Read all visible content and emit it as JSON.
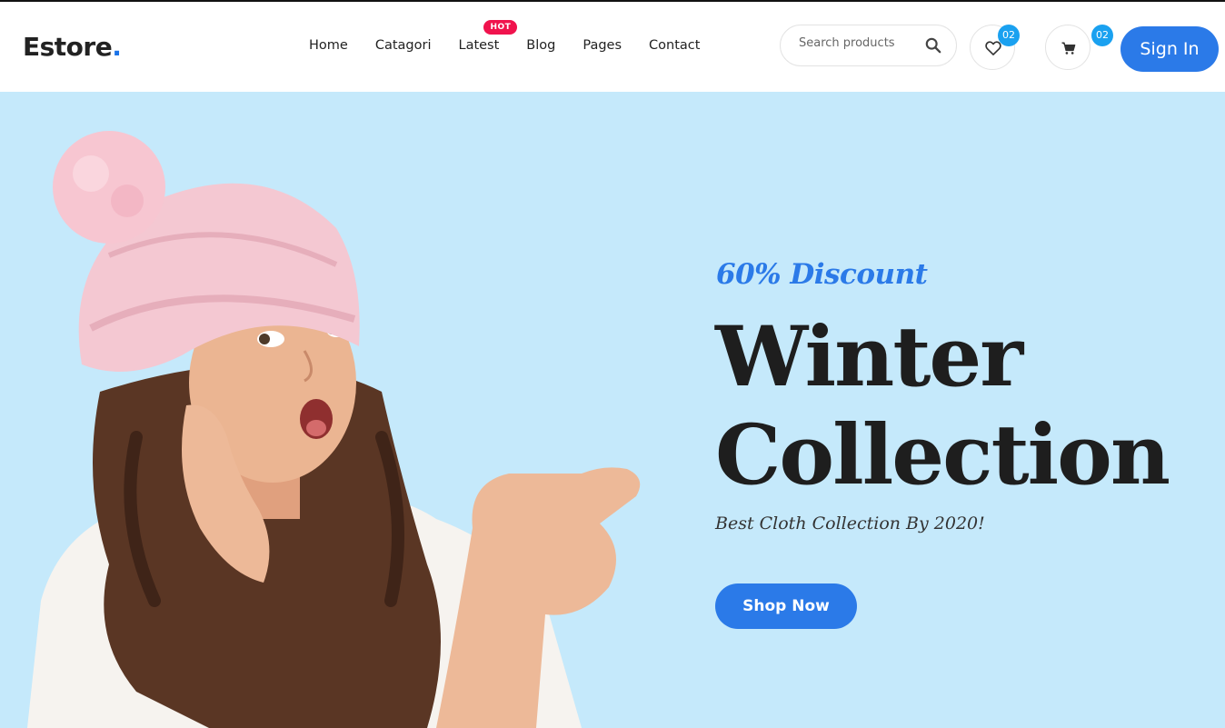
{
  "brand": {
    "name": "Estore",
    "dot": "."
  },
  "nav": {
    "items": [
      "Home",
      "Catagori",
      "Latest",
      "Blog",
      "Pages",
      "Contact"
    ],
    "hot_badge": "HOT"
  },
  "search": {
    "placeholder": "Search products",
    "icon": "search-icon"
  },
  "wishlist": {
    "icon": "heart-icon",
    "count": "02"
  },
  "cart": {
    "icon": "cart-icon",
    "count": "02"
  },
  "signin_label": "Sign In",
  "hero": {
    "discount": "60% Discount",
    "title_line1": "Winter",
    "title_line2": "Collection",
    "subtitle": "Best Cloth Collection By 2020!",
    "cta_label": "Shop Now",
    "background_color": "#c5e9fb",
    "accent_color": "#2b7ae8"
  }
}
